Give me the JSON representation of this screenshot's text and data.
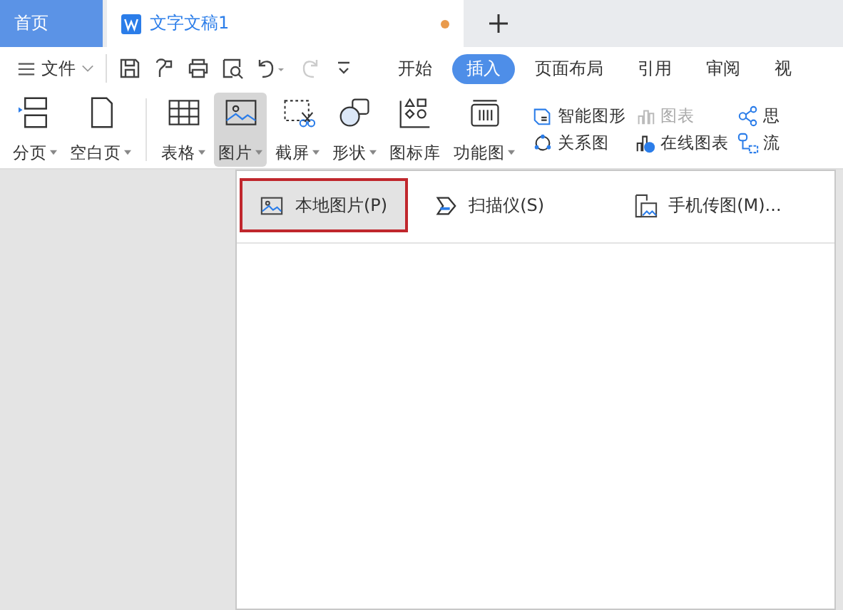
{
  "tabs": [
    {
      "label": "首页",
      "kind": "home",
      "selected": false,
      "modified": false
    },
    {
      "label": "文字文稿1",
      "kind": "document",
      "selected": true,
      "modified": true
    }
  ],
  "file_menu": {
    "label": "文件"
  },
  "quick_tools": [
    {
      "kind": "save",
      "disabled": false
    },
    {
      "kind": "painter",
      "disabled": false
    },
    {
      "kind": "print",
      "disabled": false
    },
    {
      "kind": "preview",
      "disabled": false
    },
    {
      "kind": "undo",
      "disabled": false
    },
    {
      "kind": "redo",
      "disabled": true
    },
    {
      "kind": "more",
      "disabled": false
    }
  ],
  "ribbon_tabs": [
    {
      "label": "开始",
      "selected": false
    },
    {
      "label": "插入",
      "selected": true
    },
    {
      "label": "页面布局",
      "selected": false
    },
    {
      "label": "引用",
      "selected": false
    },
    {
      "label": "审阅",
      "selected": false
    },
    {
      "label": "视",
      "selected": false
    }
  ],
  "ribbon_large": [
    {
      "label": "分页",
      "kind": "pagebreak",
      "dropdown": true,
      "pressed": false
    },
    {
      "label": "空白页",
      "kind": "blank",
      "dropdown": true,
      "pressed": false
    },
    {
      "label": "表格",
      "kind": "table",
      "dropdown": true,
      "pressed": false
    },
    {
      "label": "图片",
      "kind": "picture",
      "dropdown": true,
      "pressed": true
    },
    {
      "label": "截屏",
      "kind": "screenshot",
      "dropdown": true,
      "pressed": false
    },
    {
      "label": "形状",
      "kind": "shapes",
      "dropdown": true,
      "pressed": false
    },
    {
      "label": "图标库",
      "kind": "iconlib",
      "dropdown": false,
      "pressed": false
    },
    {
      "label": "功能图",
      "kind": "function",
      "dropdown": true,
      "pressed": false
    }
  ],
  "ribbon_small": [
    {
      "label": "智能图形",
      "kind": "smartart",
      "disabled": false
    },
    {
      "label": "关系图",
      "kind": "relation",
      "disabled": false
    },
    {
      "label": "图表",
      "kind": "chart",
      "disabled": true
    },
    {
      "label": "在线图表",
      "kind": "onlinechart",
      "disabled": false
    },
    {
      "label": "思",
      "kind": "mindmap",
      "disabled": false
    },
    {
      "label": "流",
      "kind": "flow",
      "disabled": false
    }
  ],
  "picture_menu": [
    {
      "label": "本地图片(P)",
      "kind": "local",
      "selected": true
    },
    {
      "label": "扫描仪(S)",
      "kind": "scanner",
      "selected": false
    },
    {
      "label": "手机传图(M)...",
      "kind": "phone",
      "selected": false
    }
  ]
}
